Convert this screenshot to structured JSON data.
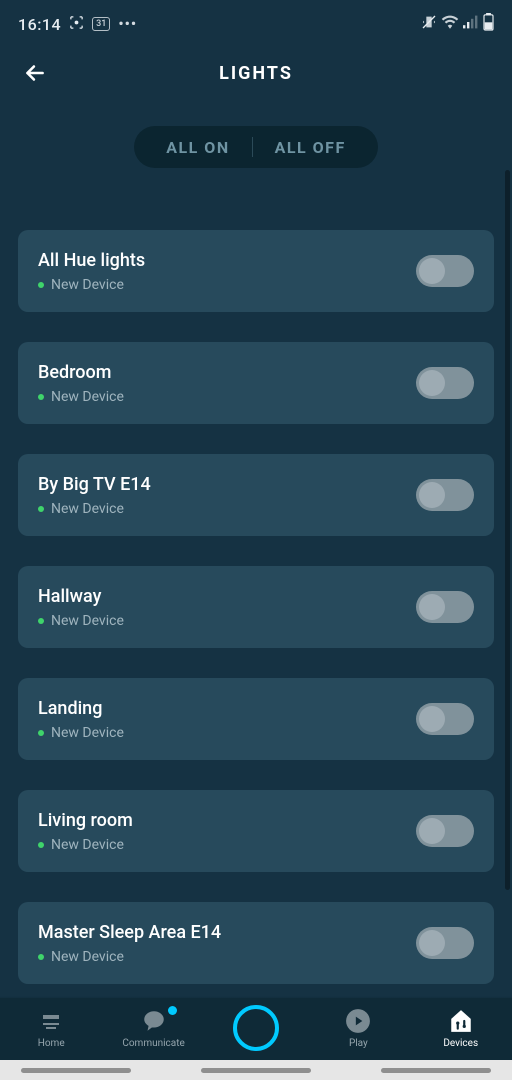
{
  "status": {
    "time": "16:14",
    "badge": "31"
  },
  "header": {
    "title": "LIGHTS"
  },
  "controls": {
    "all_on": "ALL ON",
    "all_off": "ALL OFF"
  },
  "sub_label": "New Device",
  "devices": [
    {
      "name": "All Hue lights"
    },
    {
      "name": "Bedroom"
    },
    {
      "name": "By Big TV E14"
    },
    {
      "name": "Hallway"
    },
    {
      "name": "Landing"
    },
    {
      "name": "Living room"
    },
    {
      "name": "Master Sleep Area E14"
    }
  ],
  "nav": {
    "home": "Home",
    "communicate": "Communicate",
    "play": "Play",
    "devices": "Devices"
  }
}
